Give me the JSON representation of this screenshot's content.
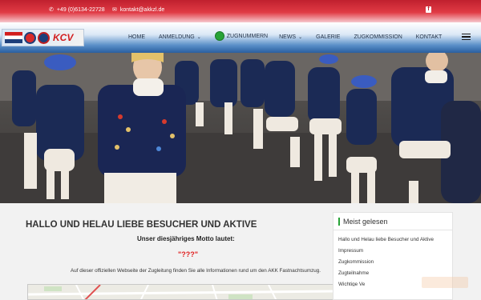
{
  "topbar": {
    "phone": "+49 (0)6134-22728",
    "email": "kontakt@akkzl.de",
    "phone_icon": "phone-icon",
    "mail_icon": "envelope-icon",
    "social_icon": "facebook-icon"
  },
  "logo": {
    "text": "KCV"
  },
  "nav": {
    "home": "HOME",
    "anmeldung": "ANMELDUNG",
    "zugnummern": "ZUGNUMMERN",
    "news": "NEWS",
    "galerie": "GALERIE",
    "zugkommission": "ZUGKOMMISSION",
    "kontakt": "KONTAKT",
    "menu_icon": "hamburger-menu-icon"
  },
  "main": {
    "headline": "HALLO UND HELAU LIEBE BESUCHER UND AKTIVE",
    "motto_label": "Unser diesjähriges Motto lautet:",
    "motto": "\"???\"",
    "intro": "Auf dieser offiziellen Webseite der Zugleitung finden Sie alle Informationen rund um den  AKK Fastnachtsumzug."
  },
  "sidebar": {
    "title": "Meist gelesen",
    "items": [
      "Hallo und Helau liebe Besucher und Aktive",
      "Impressum",
      "Zugkommission",
      "Zugteilnahme",
      "Wichtige Ve"
    ]
  },
  "colors": {
    "brand_red": "#c0202e",
    "nav_blue": "#2b5fa0",
    "accent_green": "#27a337",
    "motto_red": "#e02020"
  }
}
